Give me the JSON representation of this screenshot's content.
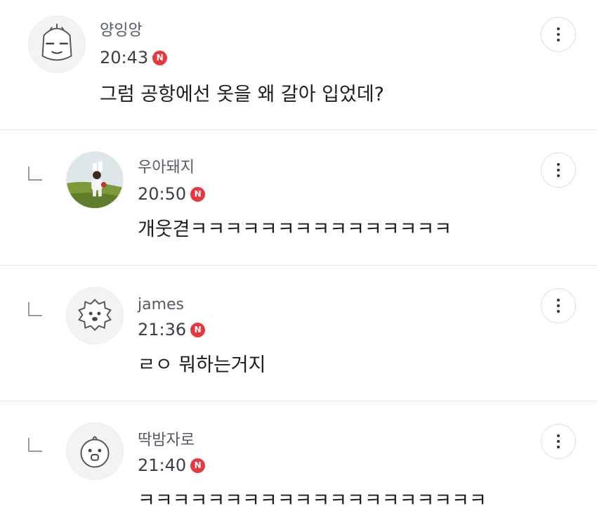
{
  "comments": [
    {
      "author": "양잉앙",
      "time": "20:43",
      "badge": "N",
      "text": "그럼 공항에선 옷을 왜 갈아 입었데?",
      "avatar": "cartoon-face-icon",
      "is_reply": false
    },
    {
      "author": "우아돼지",
      "time": "20:50",
      "badge": "N",
      "text": "개웃겯ㅋㅋㅋㅋㅋㅋㅋㅋㅋㅋㅋㅋㅋㅋㅋ",
      "avatar": "photo-avatar",
      "is_reply": true
    },
    {
      "author": "james",
      "time": "21:36",
      "badge": "N",
      "text": "ㄹㅇ 뭐하는거지",
      "avatar": "lion-face-icon",
      "is_reply": true
    },
    {
      "author": "딱밤자로",
      "time": "21:40",
      "badge": "N",
      "text": "ㅋㅋㅋㅋㅋㅋㅋㅋㅋㅋㅋㅋㅋㅋㅋㅋㅋㅋㅋㅋ",
      "avatar": "bird-face-icon",
      "is_reply": true
    }
  ],
  "icons": {
    "more": "more-vertical-icon",
    "reply": "reply-arrow-icon",
    "new": "new-badge-icon"
  },
  "colors": {
    "badge": "#e8383d",
    "divider": "#e9e9e9",
    "name": "#555b66"
  }
}
